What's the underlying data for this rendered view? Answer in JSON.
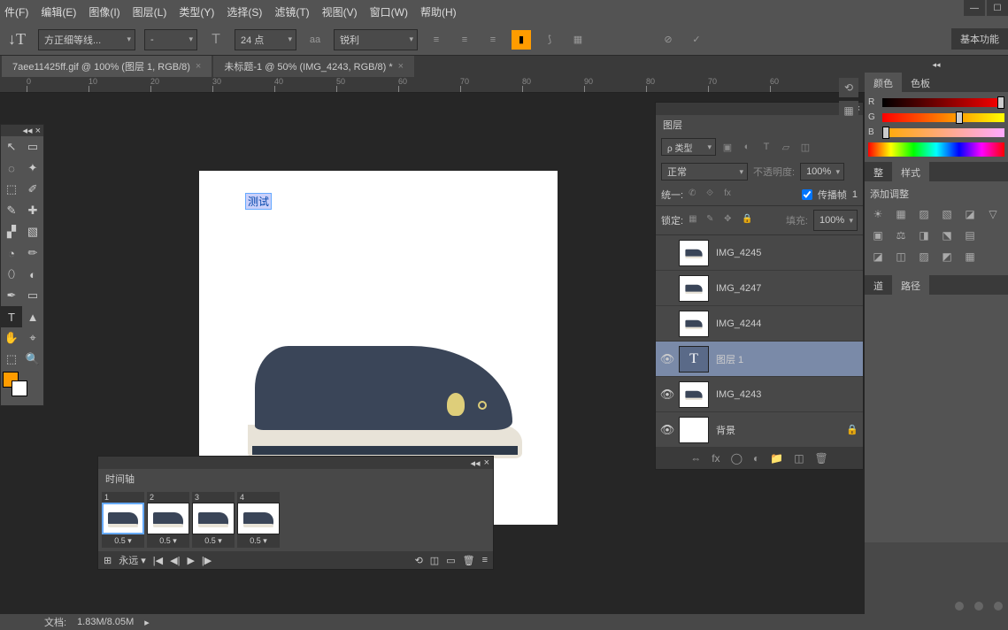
{
  "menu": {
    "items": [
      "件(F)",
      "编辑(E)",
      "图像(I)",
      "图层(L)",
      "类型(Y)",
      "选择(S)",
      "滤镜(T)",
      "视图(V)",
      "窗口(W)",
      "帮助(H)"
    ]
  },
  "optbar": {
    "tool_glyph": "↓T",
    "font": "方正细等线...",
    "style": "-",
    "size_icon": "T",
    "size": "24 点",
    "aa_label": "aa",
    "aa": "锐利",
    "align": [
      "≡",
      "≡",
      "≡"
    ],
    "color": "#ff9c00",
    "warp": "⟆",
    "panel": "▦",
    "cancel": "⊘",
    "commit": "✓"
  },
  "right_tag": "基本功能",
  "tabs": [
    {
      "label": "7aee11425ff.gif @ 100% (图层 1, RGB/8)",
      "active": false
    },
    {
      "label": "未标题-1 @ 50% (IMG_4243, RGB/8) *",
      "active": true
    }
  ],
  "ruler": [
    "0",
    "10",
    "20",
    "30",
    "40",
    "50",
    "60",
    "70",
    "80",
    "90"
  ],
  "canvas_text": "测试",
  "tools": [
    [
      "↖",
      "▭"
    ],
    [
      "◌",
      "✦"
    ],
    [
      "⬚",
      "✐"
    ],
    [
      "✎",
      "✚"
    ],
    [
      "▞",
      "▧"
    ],
    [
      "◔",
      "✏"
    ],
    [
      "⬯",
      "◐"
    ],
    [
      "✒",
      "▭"
    ],
    [
      "T",
      "▲"
    ],
    [
      "✋",
      "⌖"
    ],
    [
      "⬚",
      "🔍"
    ]
  ],
  "timeline": {
    "title": "时间轴",
    "frames": [
      {
        "n": "1",
        "d": "0.5 ▾"
      },
      {
        "n": "2",
        "d": "0.5 ▾"
      },
      {
        "n": "3",
        "d": "0.5 ▾"
      },
      {
        "n": "4",
        "d": "0.5 ▾"
      }
    ],
    "loop": "永远",
    "ctrls": [
      "|◀",
      "◀|",
      "▶",
      "|▶"
    ],
    "extra": [
      "⟲",
      "◫",
      "▭",
      "🗑"
    ]
  },
  "layers": {
    "title": "图层",
    "filter_label": "ρ 类型",
    "filter_icons": [
      "▣",
      "◐",
      "T",
      "▱",
      "◫"
    ],
    "blend": "正常",
    "opacity_lbl": "不透明度:",
    "opacity": "100%",
    "unify": "统一:",
    "unify_icons": [
      "✆",
      "⟐",
      "fx"
    ],
    "propagate_lbl": "传播帧",
    "propagate_val": "1",
    "lock_lbl": "锁定:",
    "lock_icons": [
      "▦",
      "✎",
      "✥",
      "🔒"
    ],
    "fill_lbl": "填充:",
    "fill": "100%",
    "items": [
      {
        "vis": "",
        "name": "IMG_4245",
        "thumb": "img"
      },
      {
        "vis": "",
        "name": "IMG_4247",
        "thumb": "img"
      },
      {
        "vis": "",
        "name": "IMG_4244",
        "thumb": "img"
      },
      {
        "vis": "👁",
        "name": "图层 1",
        "thumb": "T",
        "sel": true
      },
      {
        "vis": "👁",
        "name": "IMG_4243",
        "thumb": "img"
      },
      {
        "vis": "👁",
        "name": "背景",
        "thumb": "blank",
        "lock": "🔒"
      }
    ],
    "bottom": [
      "⇔",
      "fx",
      "◯",
      "◐",
      "📁",
      "◫",
      "🗑"
    ]
  },
  "color": {
    "tabs": [
      "颜色",
      "色板"
    ],
    "ch": [
      "R",
      "G",
      "B"
    ]
  },
  "styles": {
    "tabs": [
      "整",
      "样式"
    ]
  },
  "adjust": {
    "label": "添加调整",
    "r1": [
      "☀",
      "▦",
      "▨",
      "▧",
      "◪",
      "▽"
    ],
    "r2": [
      "▣",
      "⚖",
      "◨",
      "⬔",
      "▤"
    ],
    "r3": [
      "◪",
      "◫",
      "▨",
      "◩",
      "▦"
    ]
  },
  "paths": {
    "tabs": [
      "道",
      "路径"
    ]
  },
  "status": {
    "doc": "文档:",
    "size": "1.83M/8.05M"
  }
}
